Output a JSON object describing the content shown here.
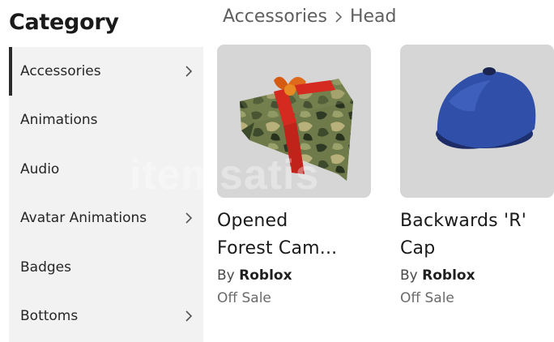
{
  "sidebar": {
    "title": "Category",
    "items": [
      {
        "label": "Accessories",
        "has_chevron": true,
        "active": true
      },
      {
        "label": "Animations",
        "has_chevron": false,
        "active": false
      },
      {
        "label": "Audio",
        "has_chevron": false,
        "active": false
      },
      {
        "label": "Avatar Animations",
        "has_chevron": true,
        "active": false
      },
      {
        "label": "Badges",
        "has_chevron": false,
        "active": false
      },
      {
        "label": "Bottoms",
        "has_chevron": true,
        "active": false
      }
    ]
  },
  "breadcrumb": {
    "parent": "Accessories",
    "current": "Head"
  },
  "items": [
    {
      "name": "Opened\nForest Cam...",
      "by_label": "By",
      "creator": "Roblox",
      "price": "Off Sale",
      "thumbnail_icon": "camo-gift-hat-icon"
    },
    {
      "name": "Backwards 'R'\nCap",
      "by_label": "By",
      "creator": "Roblox",
      "price": "Off Sale",
      "thumbnail_icon": "blue-cap-icon"
    }
  ],
  "watermark": "itemsatis",
  "colors": {
    "sidebar_bg": "#f2f2f2",
    "active_indicator": "#2b2b2b",
    "thumb_bg": "#d6d6d6",
    "cap_blue": "#2f4fa8",
    "gift_red": "#d42a1f"
  }
}
